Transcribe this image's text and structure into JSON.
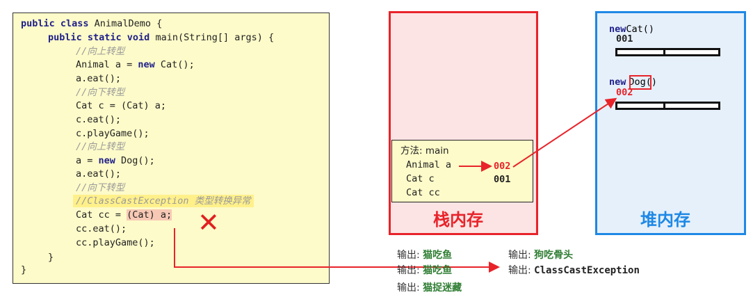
{
  "code": {
    "l1_kw": "public class",
    "l1_rest": " AnimalDemo {",
    "l2_kw": "public static void",
    "l2_rest": " main(String[] args) {",
    "l3": "//向上转型",
    "l4_a": "Animal a = ",
    "l4_kw": "new",
    "l4_b": " Cat();",
    "l5": "a.eat();",
    "l6": "//向下转型",
    "l7": "Cat c = (Cat) a;",
    "l8": "c.eat();",
    "l9": "c.playGame();",
    "l10": "//向上转型",
    "l11_a": "a = ",
    "l11_kw": "new",
    "l11_b": " Dog();",
    "l12": "a.eat();",
    "l13": "//向下转型",
    "l14": "//ClassCastException 类型转换异常",
    "l15_a": "Cat cc = ",
    "l15_b": "(Cat) a;",
    "l16": "cc.eat();",
    "l17": "cc.playGame();",
    "l18": "}",
    "l19": "}"
  },
  "stack": {
    "method": "方法: main",
    "var_a": "Animal a",
    "var_c": "Cat c",
    "var_cc": "Cat cc",
    "val_a": "002",
    "val_c": "001",
    "title": "栈内存"
  },
  "heap": {
    "obj1_kw": "new",
    "obj1_type": "Cat",
    "obj1_paren": "()",
    "obj1_addr": "001",
    "obj2_kw": "new",
    "obj2_type": "Dog",
    "obj2_paren": "()",
    "obj2_addr": "002",
    "title": "堆内存"
  },
  "output": {
    "label": "输出:",
    "left": [
      "猫吃鱼",
      "猫吃鱼",
      "猫捉迷藏"
    ],
    "right": [
      "狗吃骨头",
      "ClassCastException"
    ]
  },
  "colors": {
    "red": "#e8232a",
    "blue": "#1e88e5",
    "green": "#2e7d32"
  }
}
